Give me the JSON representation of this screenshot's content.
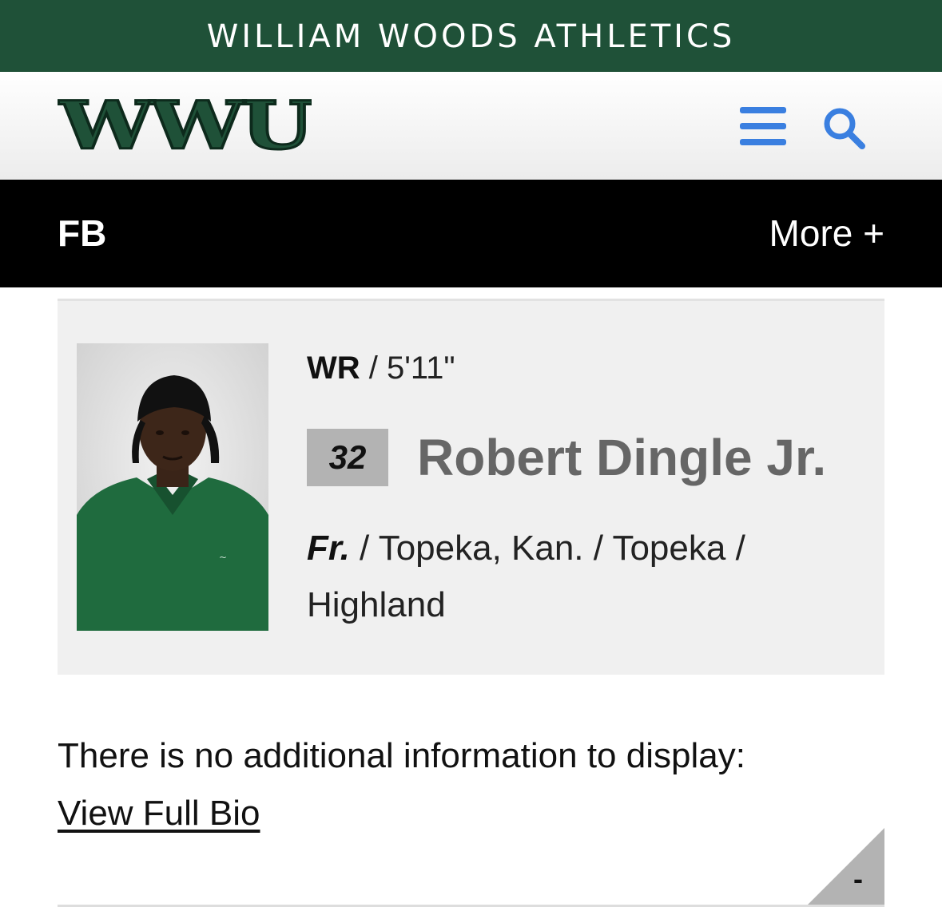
{
  "site": {
    "title": "WILLIAM WOODS ATHLETICS",
    "logo_text": "WWU",
    "brand_color": "#1f5138",
    "accent_color": "#3a7fe0"
  },
  "header": {
    "menu_icon": "hamburger-menu-icon",
    "search_icon": "search-icon"
  },
  "subnav": {
    "sport": "FB",
    "more_label": "More +"
  },
  "player": {
    "position": "WR",
    "height": "5'11\"",
    "number": "32",
    "name": "Robert Dingle Jr.",
    "class_year": "Fr.",
    "hometown": "Topeka, Kan.",
    "previous_school": "Topeka",
    "high_school": "Highland"
  },
  "bio": {
    "no_info_text": "There is no additional information to display:",
    "view_full_bio": "View Full Bio",
    "collapse_label": "-"
  }
}
